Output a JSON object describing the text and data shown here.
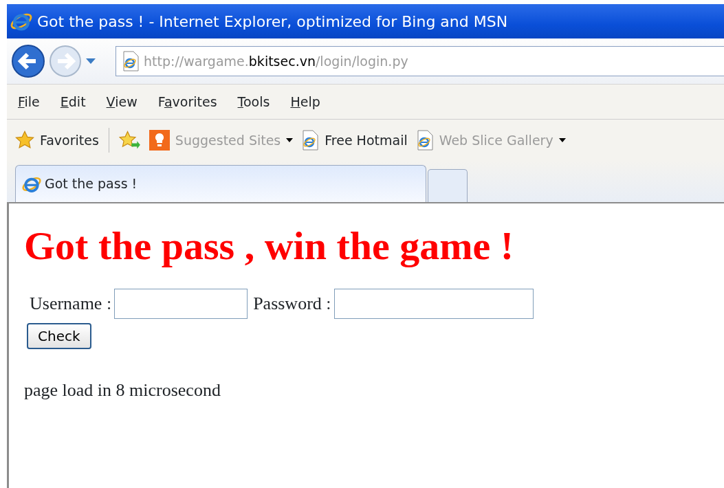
{
  "window": {
    "title": "Got the pass ! - Internet Explorer, optimized for Bing and MSN"
  },
  "address_bar": {
    "url_parts": [
      {
        "text": "http://wargame.",
        "highlighted": false
      },
      {
        "text": "bkitsec.vn",
        "highlighted": true
      },
      {
        "text": "/login/login.py",
        "highlighted": false
      }
    ]
  },
  "menu": [
    {
      "parts": [
        {
          "text": "F",
          "underlined": true
        },
        {
          "text": "ile",
          "underlined": false
        }
      ]
    },
    {
      "parts": [
        {
          "text": "E",
          "underlined": true
        },
        {
          "text": "dit",
          "underlined": false
        }
      ]
    },
    {
      "parts": [
        {
          "text": "V",
          "underlined": true
        },
        {
          "text": "iew",
          "underlined": false
        }
      ]
    },
    {
      "parts": [
        {
          "text": "F",
          "underlined": false
        },
        {
          "text": "a",
          "underlined": true
        },
        {
          "text": "vorites",
          "underlined": false
        }
      ]
    },
    {
      "parts": [
        {
          "text": "T",
          "underlined": true
        },
        {
          "text": "ools",
          "underlined": false
        }
      ]
    },
    {
      "parts": [
        {
          "text": "H",
          "underlined": true
        },
        {
          "text": "elp",
          "underlined": false
        }
      ]
    }
  ],
  "favorites_bar": {
    "label": "Favorites",
    "links": [
      {
        "kind": "suggested",
        "label": "Suggested Sites",
        "dimmed": true,
        "dropdown": true
      },
      {
        "kind": "page",
        "label": "Free Hotmail",
        "dimmed": false,
        "dropdown": false
      },
      {
        "kind": "page",
        "label": "Web Slice Gallery",
        "dimmed": true,
        "dropdown": true
      }
    ]
  },
  "tabs": [
    {
      "label": "Got the pass !",
      "selected": true
    }
  ],
  "page": {
    "heading": "Got the pass , win the game !",
    "fields": [
      {
        "label": "Username :"
      },
      {
        "label": "Password :"
      }
    ],
    "button": "Check",
    "footer": "page load in 8 microsecond"
  }
}
